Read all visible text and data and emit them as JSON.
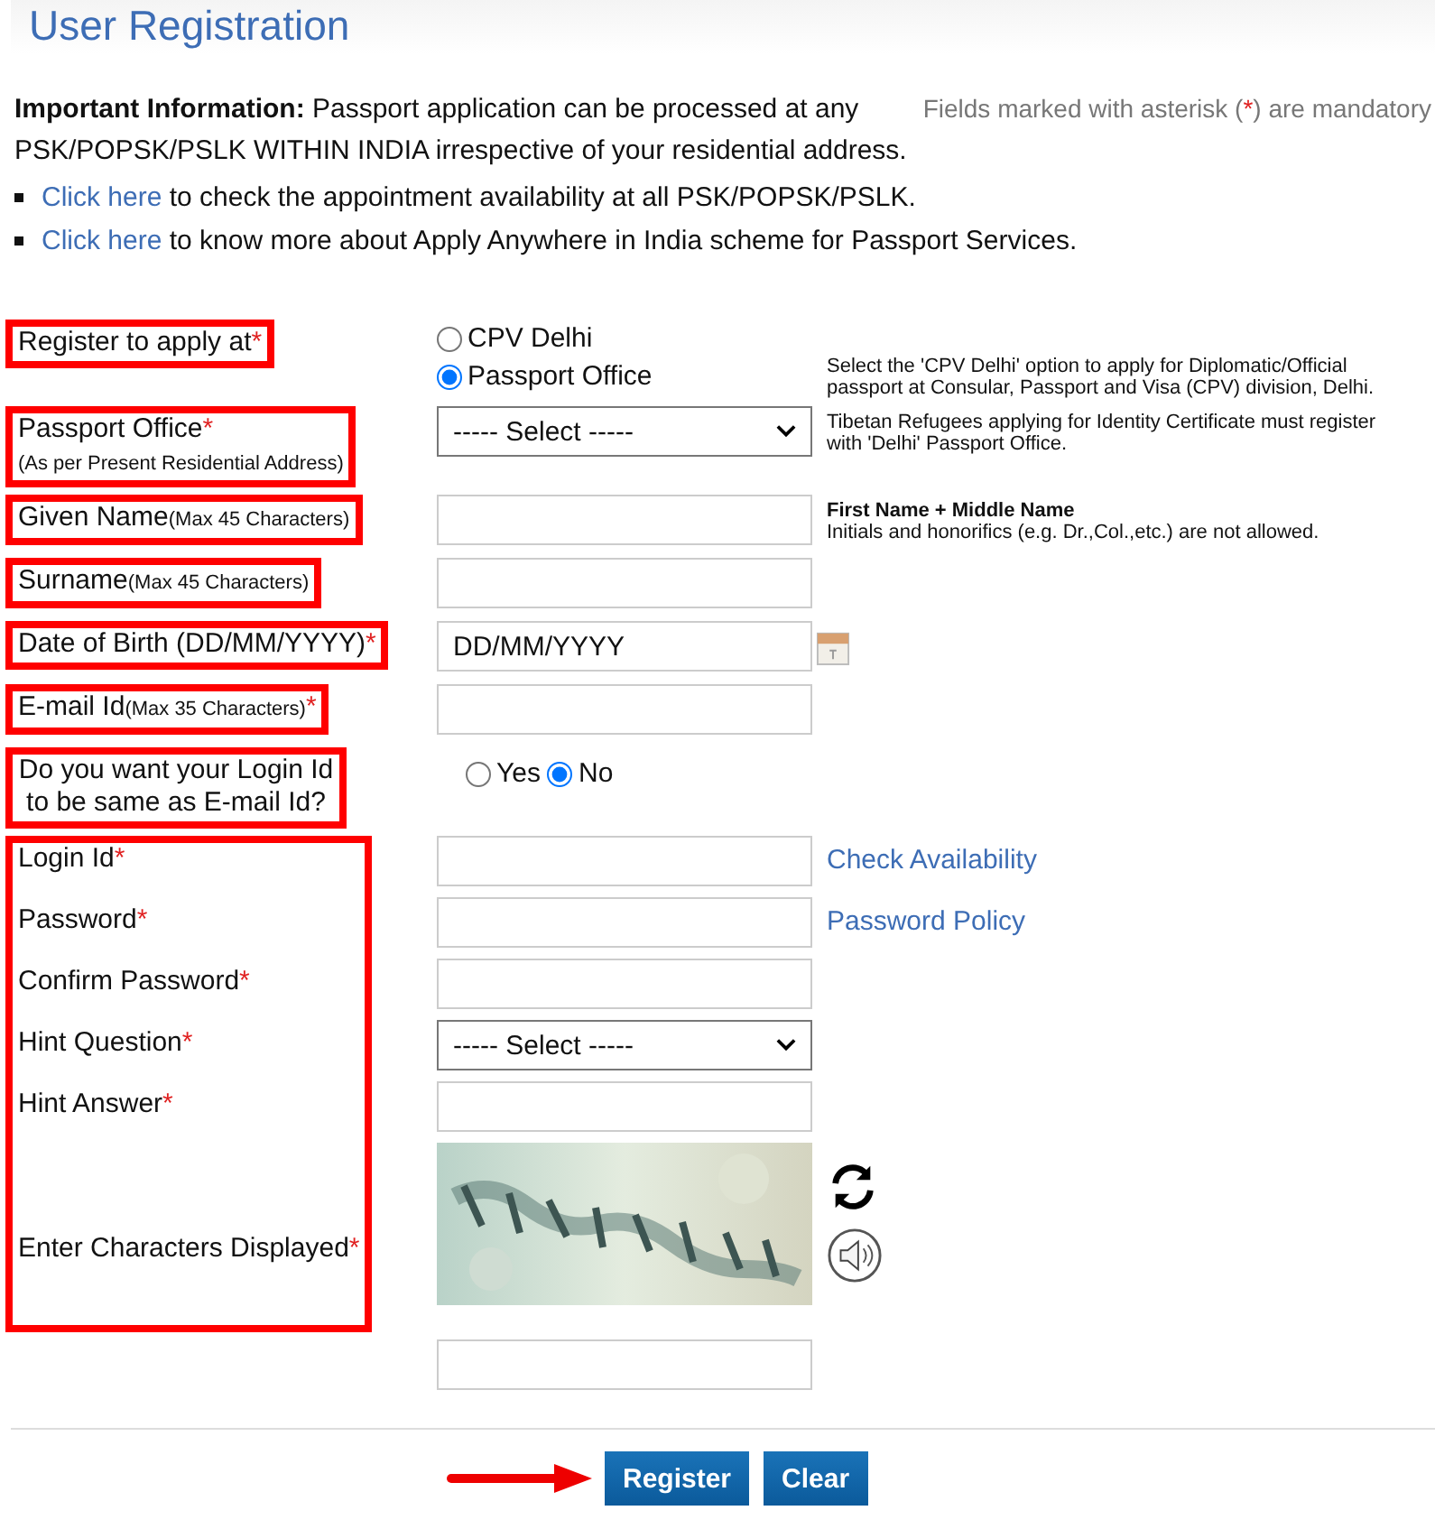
{
  "title": "User Registration",
  "info": {
    "heading": "Important Information:",
    "text": "Passport application can be processed at any PSK/POPSK/PSLK WITHIN INDIA irrespective of your residential address.",
    "note_before": "Fields marked with asterisk (",
    "note_mark": "*",
    "note_after": ") are mandatory"
  },
  "links": [
    {
      "link": "Click here",
      "text": "to check the appointment availability at all PSK/POPSK/PSLK."
    },
    {
      "link": "Click here",
      "text": "to know more about Apply Anywhere in India scheme for Passport Services."
    }
  ],
  "sections": [
    {
      "highlighted": true,
      "rows": [
        {
          "label": "Register to apply at",
          "mark": "*",
          "kind": "radio",
          "options": [
            {
              "label": "CPV Delhi",
              "selected": false
            },
            {
              "label": "Passport Office",
              "selected": true
            }
          ],
          "help": "Select the 'CPV Delhi' option to apply for Diplomatic/Official passport at Consular, Passport and Visa (CPV) division, Delhi."
        }
      ]
    },
    {
      "highlighted": true,
      "rows": [
        {
          "label": "Passport Office",
          "mark": "*",
          "subnote": "(As per Present Residential Address)",
          "kind": "select",
          "value": "----- Select -----",
          "help": "Tibetan Refugees applying for Identity Certificate must register with 'Delhi' Passport Office."
        }
      ]
    },
    {
      "highlighted": true,
      "rows": [
        {
          "label": "Given Name",
          "note": "(Max 45 Characters)",
          "kind": "text",
          "help_title": "First Name + Middle Name",
          "help": "Initials and honorifics (e.g. Dr.,Col.,etc.) are not allowed."
        }
      ]
    },
    {
      "highlighted": true,
      "rows": [
        {
          "label": "Surname",
          "note": "(Max 45 Characters)",
          "kind": "text"
        }
      ]
    },
    {
      "highlighted": true,
      "rows": [
        {
          "label": "Date of Birth (DD/MM/YYYY)",
          "mark": "*",
          "kind": "date",
          "value": "DD/MM/YYYY"
        }
      ]
    },
    {
      "highlighted": true,
      "rows": [
        {
          "label": "E-mail Id",
          "note": "(Max 35 Characters)",
          "mark": "*",
          "kind": "text"
        }
      ]
    },
    {
      "highlighted": true,
      "rows": [
        {
          "label": "Do you want your Login Id to be same as E-mail Id?",
          "kind": "inline_radio",
          "options": [
            {
              "label": "Yes",
              "selected": false
            },
            {
              "label": "No",
              "selected": true
            }
          ]
        }
      ]
    },
    {
      "highlighted": true,
      "rows": [
        {
          "label": "Login Id",
          "mark": "*",
          "kind": "text",
          "link": "Check Availability"
        },
        {
          "label": "Password",
          "mark": "*",
          "kind": "text",
          "link": "Password Policy"
        },
        {
          "label": "Confirm Password",
          "mark": "*",
          "kind": "text"
        },
        {
          "label": "Hint Question",
          "mark": "*",
          "kind": "select",
          "value": "----- Select -----"
        },
        {
          "label": "Hint Answer",
          "mark": "*",
          "kind": "text"
        },
        {
          "label": "Enter Characters Displayed",
          "mark": "*",
          "kind": "captcha"
        }
      ]
    },
    {
      "highlighted": false,
      "rows": [
        {
          "kind": "text"
        }
      ]
    }
  ],
  "buttons": [
    {
      "label": "Register",
      "pointed": true
    },
    {
      "label": "Clear",
      "pointed": false
    }
  ]
}
